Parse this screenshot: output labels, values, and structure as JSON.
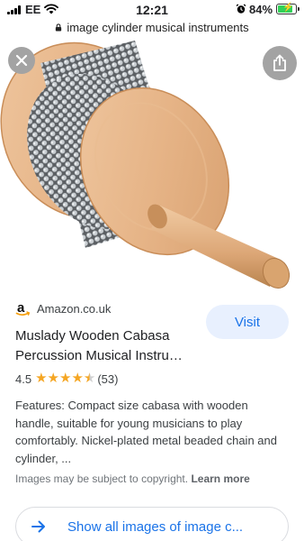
{
  "status_bar": {
    "carrier": "EE",
    "time": "12:21",
    "battery_percent": "84%",
    "battery_level": 0.84
  },
  "url_bar": {
    "text": "image cylinder musical instruments"
  },
  "image": {
    "alt": "Wooden cabasa with metal bead chains"
  },
  "result": {
    "source": "Amazon.co.uk",
    "visit_label": "Visit",
    "title_line1": "Muslady Wooden Cabasa",
    "title_line2": "Percussion Musical Instru…",
    "rating_value": "4.5",
    "rating_stars": 4.5,
    "review_count": "(53)",
    "description": "Features: Compact size cabasa with wooden handle, suitable for young musicians to play comfortably. Nickel-plated metal beaded chain and cylinder, ...",
    "copyright_text": "Images may be subject to copyright.",
    "learn_more": "Learn more",
    "show_all_label": "Show all images of image c..."
  },
  "colors": {
    "accent": "#1a73e8",
    "visit_bg": "#e8f0fe",
    "star": "#f5a623",
    "battery": "#30d158"
  }
}
